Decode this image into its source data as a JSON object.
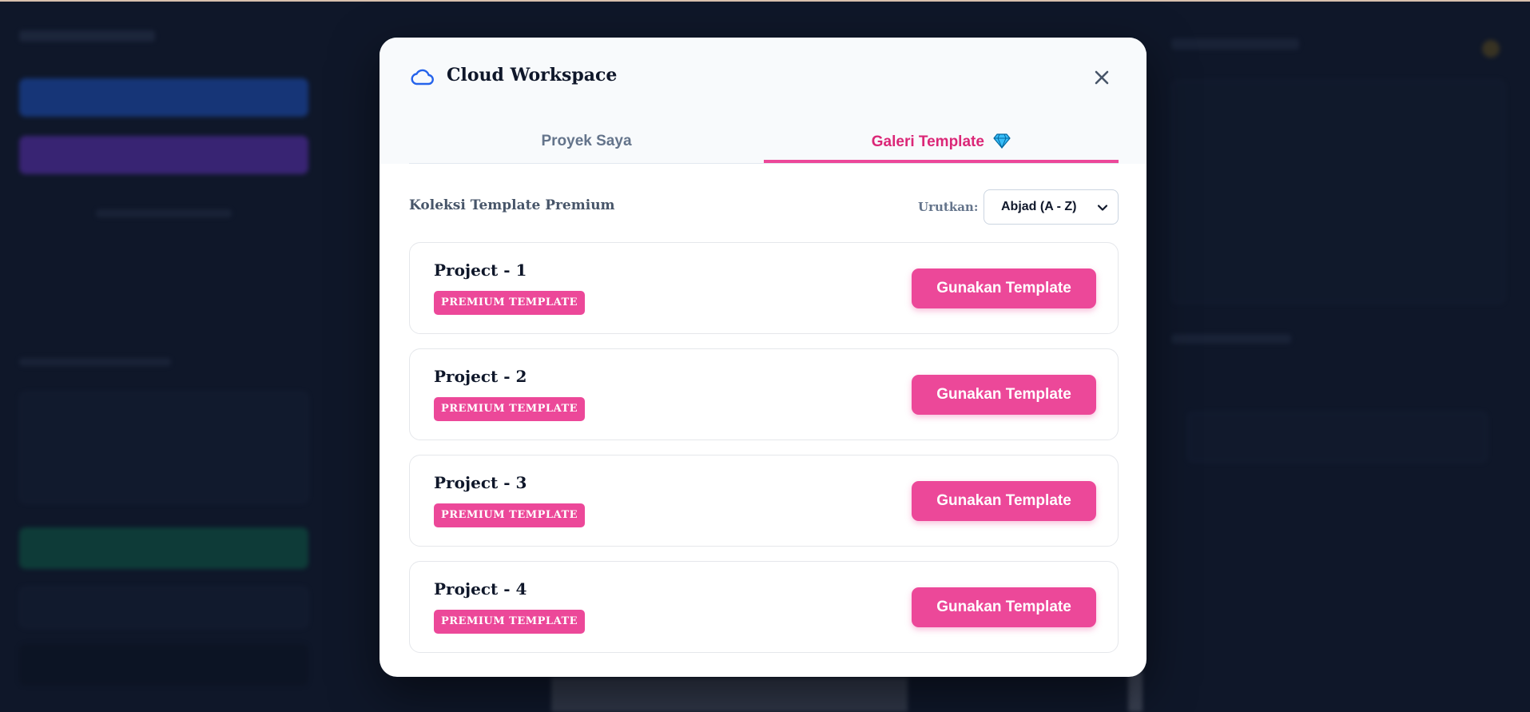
{
  "modal": {
    "title": "Cloud Workspace",
    "icon": "cloud-icon",
    "close_icon": "close-icon",
    "tabs": [
      {
        "label": "Proyek Saya",
        "active": false
      },
      {
        "label": "Galeri Template",
        "active": true,
        "icon": "diamond-icon"
      }
    ],
    "section_title": "Koleksi Template Premium",
    "sort": {
      "label": "Urutkan:",
      "value": "Abjad (A - Z)"
    },
    "templates": [
      {
        "name": "Project - 1",
        "badge": "PREMIUM TEMPLATE",
        "button": "Gunakan Template"
      },
      {
        "name": "Project - 2",
        "badge": "PREMIUM TEMPLATE",
        "button": "Gunakan Template"
      },
      {
        "name": "Project - 3",
        "badge": "PREMIUM TEMPLATE",
        "button": "Gunakan Template"
      },
      {
        "name": "Project - 4",
        "badge": "PREMIUM TEMPLATE",
        "button": "Gunakan Template"
      }
    ]
  },
  "colors": {
    "accent": "#ec4899",
    "accent_text": "#db2777",
    "backdrop": "#0f1729",
    "icon_blue": "#2563eb"
  }
}
